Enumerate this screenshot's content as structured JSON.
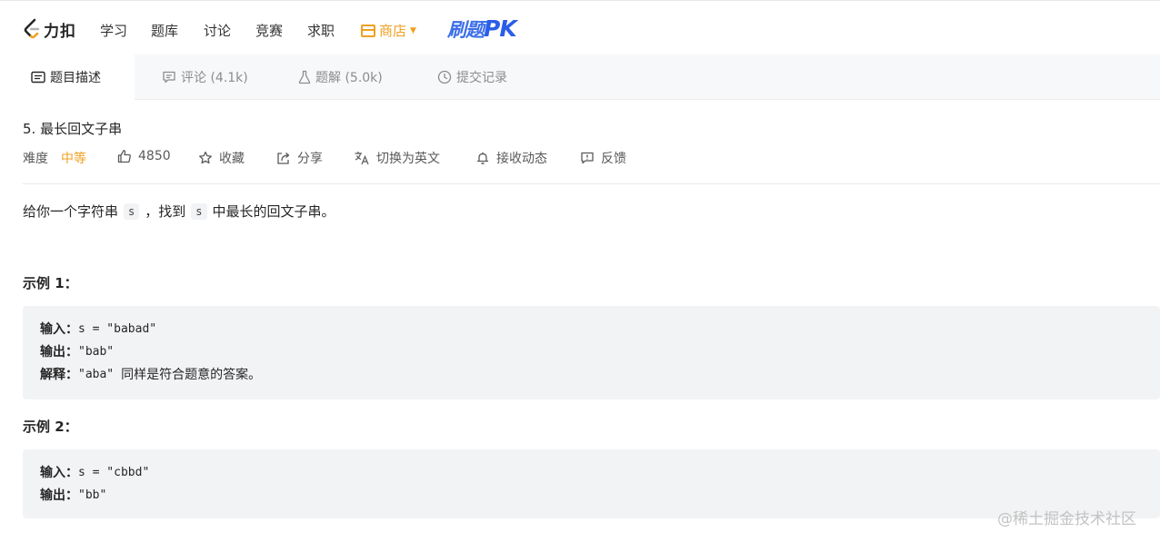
{
  "nav": {
    "logo_text": "力扣",
    "items": [
      "学习",
      "题库",
      "讨论",
      "竞赛",
      "求职"
    ],
    "shop_label": "商店",
    "promo_text": "刷题",
    "promo_text2": "PK"
  },
  "tabs": [
    {
      "label": "题目描述",
      "icon": "description-icon"
    },
    {
      "label": "评论 (4.1k)",
      "icon": "comment-icon"
    },
    {
      "label": "题解 (5.0k)",
      "icon": "flask-icon"
    },
    {
      "label": "提交记录",
      "icon": "clock-icon"
    }
  ],
  "problem": {
    "title": "5. 最长回文子串",
    "difficulty_label": "难度",
    "difficulty": "中等",
    "likes": "4850",
    "favorite_label": "收藏",
    "share_label": "分享",
    "translate_label": "切换为英文",
    "subscribe_label": "接收动态",
    "feedback_label": "反馈"
  },
  "description": {
    "part1": "给你一个字符串",
    "code1": "s",
    "part2": "，找到",
    "code2": "s",
    "part3": "中最长的回文子串。"
  },
  "examples": [
    {
      "title": "示例 1：",
      "input_label": "输入：",
      "input": "s = \"babad\"",
      "output_label": "输出：",
      "output": "\"bab\"",
      "explain_label": "解释：",
      "explain_code": "\"aba\"",
      "explain_text": "同样是符合题意的答案。"
    },
    {
      "title": "示例 2：",
      "input_label": "输入：",
      "input": "s = \"cbbd\"",
      "output_label": "输出：",
      "output": "\"bb\""
    }
  ],
  "watermark": "@稀土掘金技术社区",
  "colors": {
    "accent_orange": "#f0a020",
    "promo_blue": "#3d6fe8",
    "code_bg": "#f2f3f5"
  }
}
